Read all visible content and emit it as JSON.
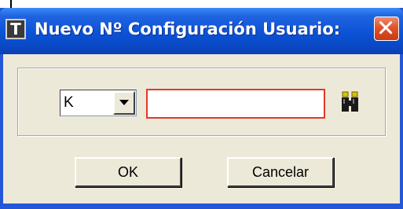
{
  "window": {
    "title": "Nuevo Nº Configuración Usuario:",
    "app_icon_letter": "T"
  },
  "form": {
    "combo_value": "K",
    "text_value": ""
  },
  "buttons": {
    "ok_label": "OK",
    "cancel_label": "Cancelar"
  },
  "icons": {
    "app": "app-t-icon",
    "close": "close-icon",
    "dropdown": "chevron-down-icon",
    "search": "binoculars-icon"
  },
  "colors": {
    "titlebar": "#0b52d6",
    "close_button": "#e0542b",
    "input_border": "#e0392b",
    "dialog_background": "#ece9d8"
  }
}
